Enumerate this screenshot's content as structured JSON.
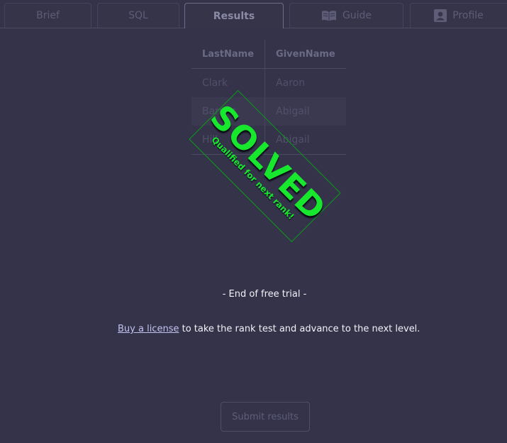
{
  "tabs": {
    "brief": "Brief",
    "sql": "SQL",
    "results": "Results",
    "guide": "Guide",
    "profile": "Profile"
  },
  "table": {
    "headers": [
      "LastName",
      "GivenName"
    ],
    "rows": [
      [
        "Clark",
        "Aaron"
      ],
      [
        "Barnes",
        "Abigail"
      ],
      [
        "Hill",
        "Abigail"
      ]
    ]
  },
  "stamp": {
    "title": "SOLVED",
    "subtitle": "Qualified for next rank!"
  },
  "messages": {
    "end_trial": "- End of free trial -",
    "license_link": "Buy a license",
    "license_text": " to take the rank test and advance to the next level."
  },
  "submit_label": "Submit results",
  "colors": {
    "background": "#34334a",
    "stamp_green": "#17e82e",
    "link": "#c3c3f0"
  },
  "icons": {
    "guide": "book-icon",
    "profile": "profile-icon"
  }
}
